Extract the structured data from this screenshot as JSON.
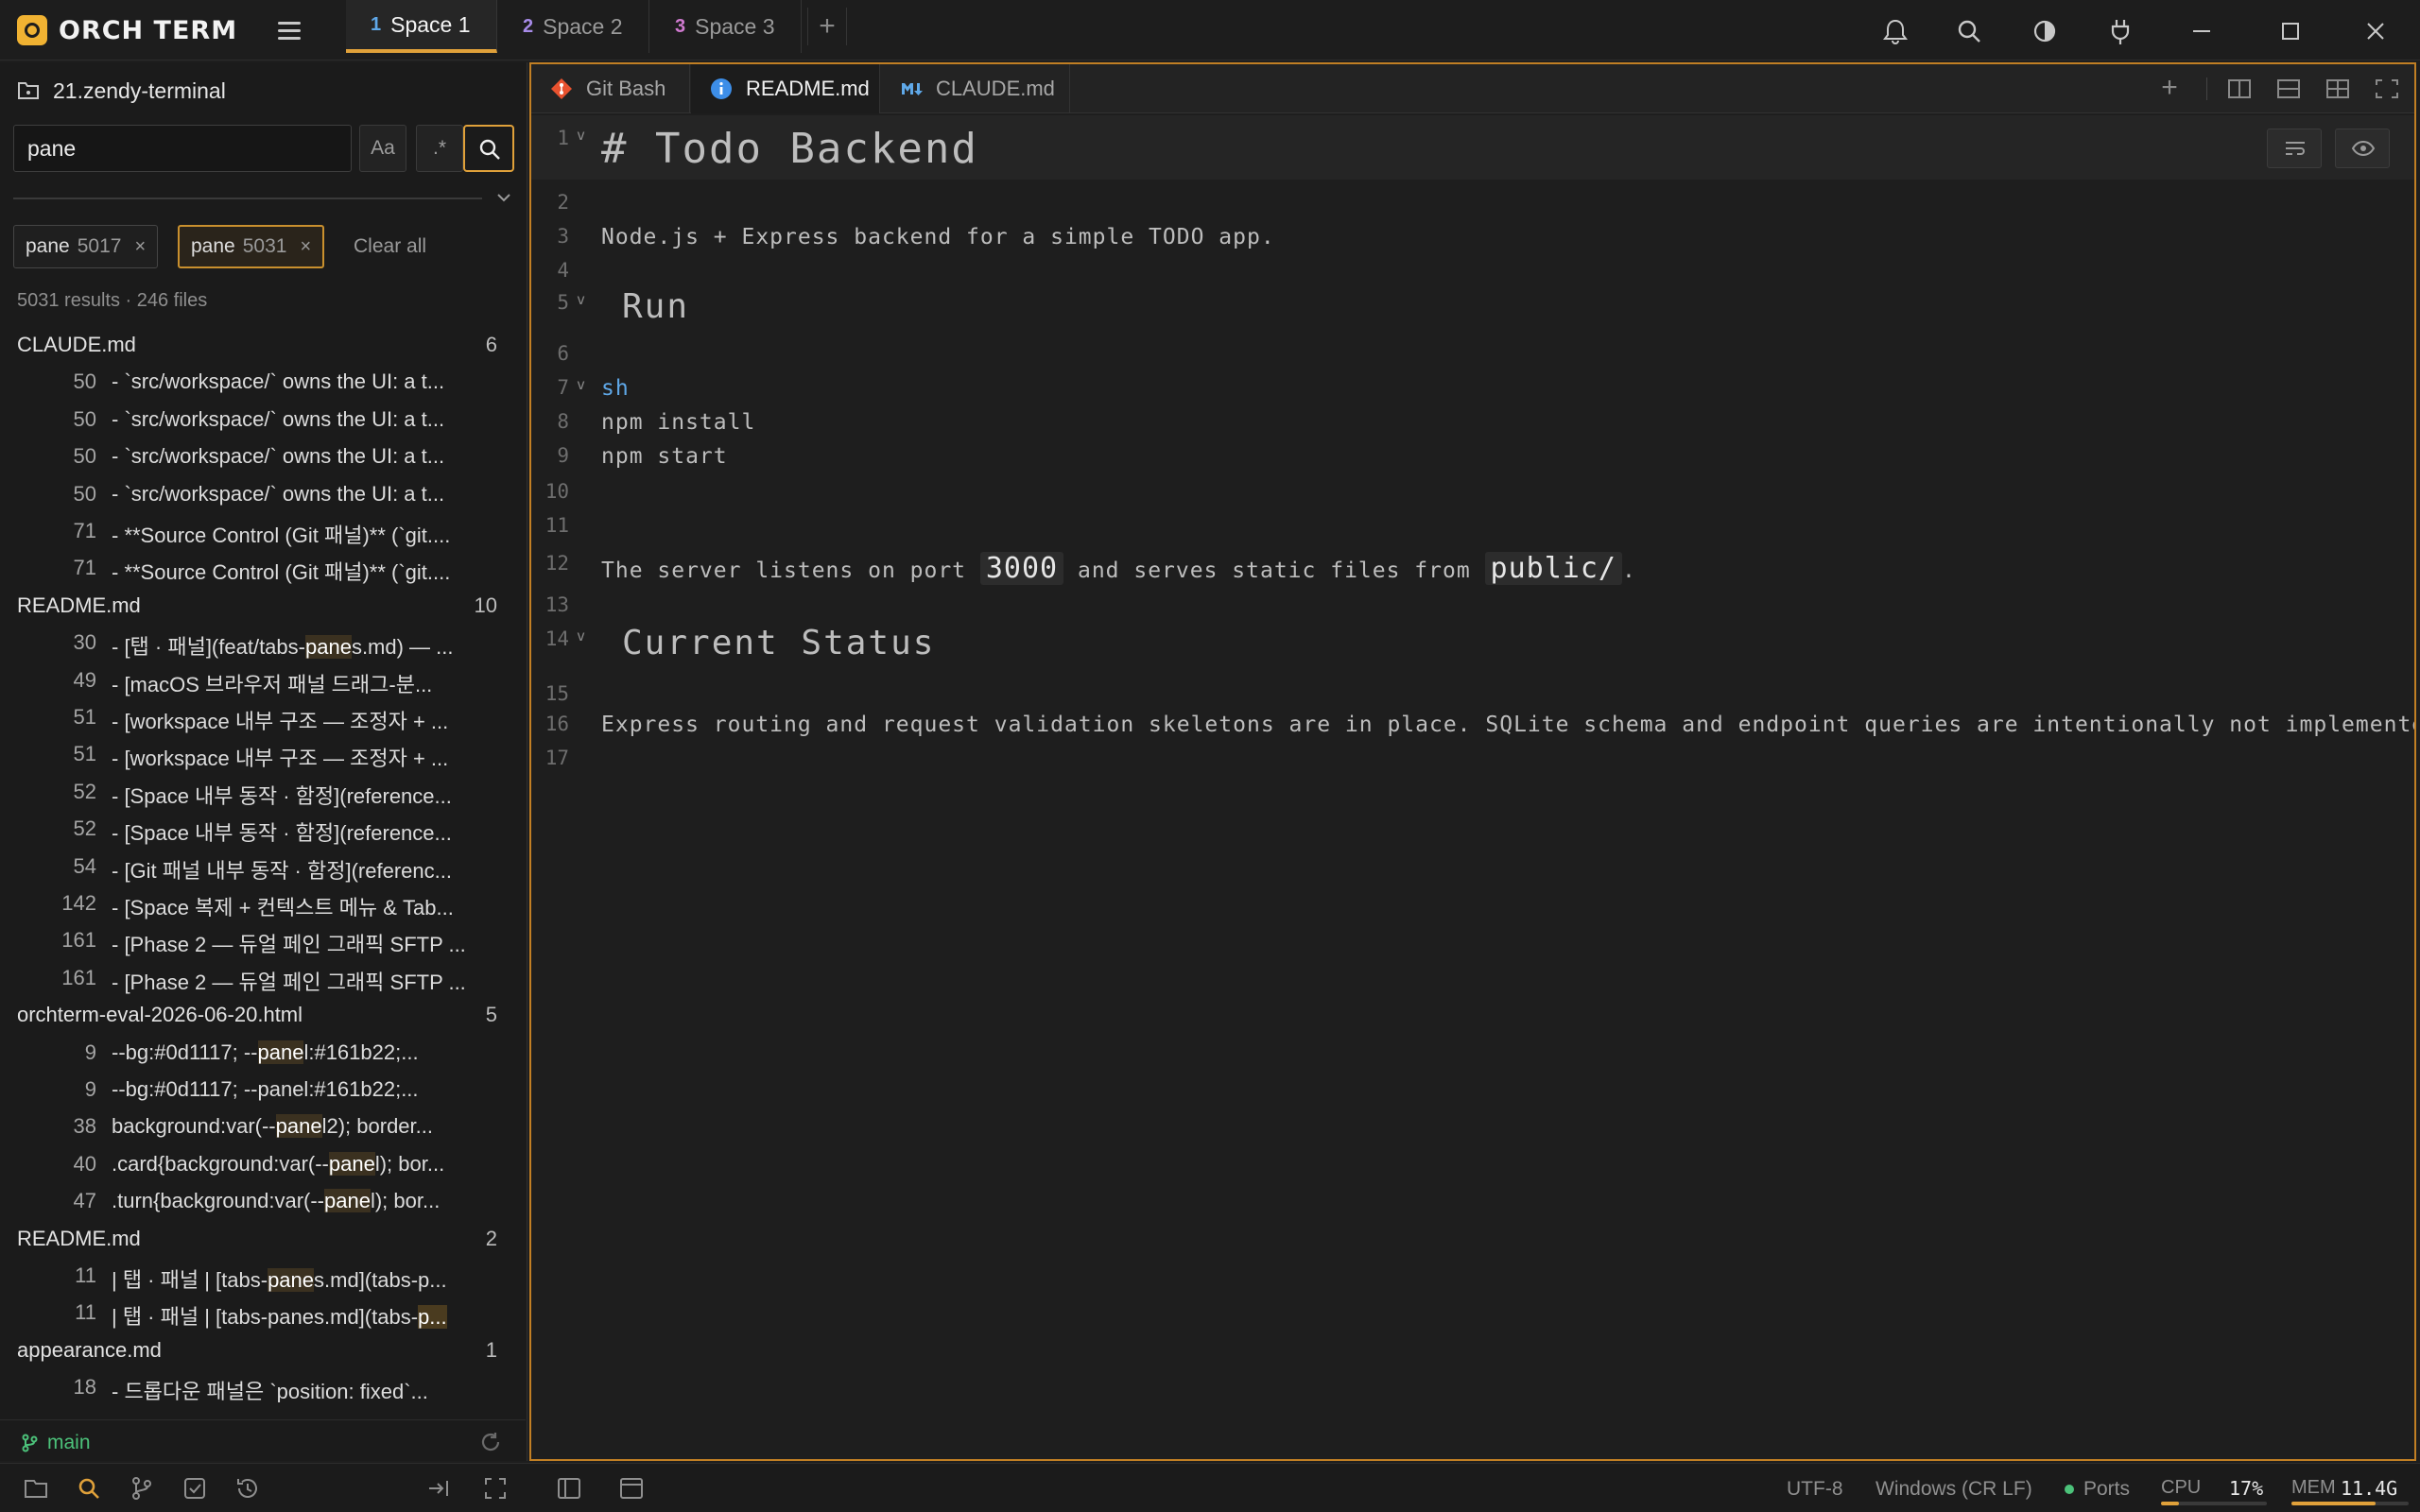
{
  "app": {
    "title": "ORCH TERM"
  },
  "spaces": [
    {
      "num": "1",
      "label": "Space 1",
      "num_color": "#5fa8e8"
    },
    {
      "num": "2",
      "label": "Space 2",
      "num_color": "#a78be8"
    },
    {
      "num": "3",
      "label": "Space 3",
      "num_color": "#d07ad0"
    }
  ],
  "add_space": "+",
  "sidebar": {
    "project": "21.zendy-terminal",
    "search": {
      "value": "pane",
      "match_case": "Aa",
      "regex": ".*"
    },
    "chips": [
      {
        "term": "pane",
        "count": "5017",
        "close": "×"
      },
      {
        "term": "pane",
        "count": "5031",
        "close": "×"
      }
    ],
    "clear_all": "Clear all",
    "summary": "5031 results · 246 files",
    "groups": [
      {
        "file": "CLAUDE.md",
        "count": "6",
        "matches": [
          {
            "line": "50",
            "pre": "- `src/workspace/` owns the UI: a t...",
            "hl": "",
            "post": ""
          },
          {
            "line": "50",
            "pre": "- `src/workspace/` owns the UI: a t...",
            "hl": "",
            "post": ""
          },
          {
            "line": "50",
            "pre": "- `src/workspace/` owns the UI: a t...",
            "hl": "",
            "post": ""
          },
          {
            "line": "50",
            "pre": "- `src/workspace/` owns the UI: a t...",
            "hl": "",
            "post": ""
          },
          {
            "line": "71",
            "pre": "- **Source Control (Git 패널)** (`git....",
            "hl": "",
            "post": ""
          },
          {
            "line": "71",
            "pre": "- **Source Control (Git 패널)** (`git....",
            "hl": "",
            "post": ""
          }
        ]
      },
      {
        "file": "README.md",
        "count": "10",
        "matches": [
          {
            "line": "30",
            "pre": "- [탭 · 패널](feat/tabs-",
            "hl": "pane",
            "post": "s.md) — ..."
          },
          {
            "line": "49",
            "pre": "- [macOS 브라우저 패널 드래그-분...",
            "hl": "",
            "post": ""
          },
          {
            "line": "51",
            "pre": "- [workspace 내부 구조 — 조정자 + ...",
            "hl": "",
            "post": ""
          },
          {
            "line": "51",
            "pre": "- [workspace 내부 구조 — 조정자 + ...",
            "hl": "",
            "post": ""
          },
          {
            "line": "52",
            "pre": "- [Space 내부 동작 · 함정](reference...",
            "hl": "",
            "post": ""
          },
          {
            "line": "52",
            "pre": "- [Space 내부 동작 · 함정](reference...",
            "hl": "",
            "post": ""
          },
          {
            "line": "54",
            "pre": "- [Git 패널 내부 동작 · 함정](referenc...",
            "hl": "",
            "post": ""
          },
          {
            "line": "142",
            "pre": "- [Space 복제 + 컨텍스트 메뉴 & Tab...",
            "hl": "",
            "post": ""
          },
          {
            "line": "161",
            "pre": "- [Phase 2 — 듀얼 페인 그래픽 SFTP ...",
            "hl": "",
            "post": ""
          },
          {
            "line": "161",
            "pre": "- [Phase 2 — 듀얼 페인 그래픽 SFTP ...",
            "hl": "",
            "post": ""
          }
        ]
      },
      {
        "file": "orchterm-eval-2026-06-20.html",
        "count": "5",
        "matches": [
          {
            "line": "9",
            "pre": "    --bg:#0d1117; --",
            "hl": "pane",
            "post": "l:#161b22;..."
          },
          {
            "line": "9",
            "pre": "    --bg:#0d1117; --panel:#161b22;...",
            "hl": "",
            "post": ""
          },
          {
            "line": "38",
            "pre": "  background:var(--",
            "hl": "pane",
            "post": "l2); border..."
          },
          {
            "line": "40",
            "pre": " .card{background:var(--",
            "hl": "pane",
            "post": "l); bor..."
          },
          {
            "line": "47",
            "pre": " .turn{background:var(--",
            "hl": "pane",
            "post": "l); bor..."
          }
        ]
      },
      {
        "file": "README.md",
        "count": "2",
        "matches": [
          {
            "line": "11",
            "pre": "| 탭 · 패널 | [tabs-",
            "hl": "pane",
            "post": "s.md](tabs-p..."
          },
          {
            "line": "11",
            "pre": "| 탭 · 패널 | [tabs-panes.md](tabs-",
            "hl": "p...",
            "post": ""
          }
        ]
      },
      {
        "file": "appearance.md",
        "count": "1",
        "matches": [
          {
            "line": "18",
            "pre": " - 드롭다운 패널은 `position: fixed`...",
            "hl": "",
            "post": ""
          }
        ]
      }
    ],
    "branch": "main"
  },
  "editor": {
    "tabs": [
      {
        "label": "Git Bash",
        "icon": "git-icon"
      },
      {
        "label": "README.md",
        "icon": "info-icon"
      },
      {
        "label": "CLAUDE.md",
        "icon": "markdown-icon"
      }
    ],
    "add_tab": "+",
    "lines": [
      {
        "n": "1",
        "fold": "v",
        "kind": "h1",
        "text": "# Todo Backend"
      },
      {
        "n": "2",
        "kind": "text",
        "text": ""
      },
      {
        "n": "3",
        "kind": "text",
        "text": "Node.js + Express backend for a simple TODO app."
      },
      {
        "n": "4",
        "kind": "text",
        "text": ""
      },
      {
        "n": "5",
        "fold": "v",
        "kind": "h2",
        "text": "Run"
      },
      {
        "n": "6",
        "kind": "text",
        "text": ""
      },
      {
        "n": "7",
        "fold": "v",
        "kind": "lang",
        "text": "sh"
      },
      {
        "n": "8",
        "kind": "text",
        "text": "npm install"
      },
      {
        "n": "9",
        "kind": "text",
        "text": "npm start"
      },
      {
        "n": "10",
        "kind": "text",
        "text": ""
      },
      {
        "n": "11",
        "kind": "text",
        "text": ""
      },
      {
        "n": "12",
        "kind": "mixed",
        "parts": [
          {
            "t": "The server listens on port "
          },
          {
            "c": "3000"
          },
          {
            "t": " and serves static files from "
          },
          {
            "c": "public/"
          },
          {
            "t": "."
          }
        ]
      },
      {
        "n": "13",
        "kind": "text",
        "text": ""
      },
      {
        "n": "14",
        "fold": "v",
        "kind": "h2",
        "text": "Current Status"
      },
      {
        "n": "15",
        "kind": "text",
        "text": ""
      },
      {
        "n": "16",
        "kind": "text",
        "text": "Express routing and request validation skeletons are in place. SQLite schema and endpoint queries are intentionally not implemented yet be"
      },
      {
        "n": "17",
        "kind": "text",
        "text": ""
      }
    ]
  },
  "status": {
    "encoding": "UTF-8",
    "eol": "Windows (CR LF)",
    "ports": "Ports",
    "cpu_label": "CPU",
    "cpu_value": "17%",
    "cpu_fraction": 0.17,
    "mem_label": "MEM",
    "mem_value": "11.4G",
    "mem_fraction": 0.72
  },
  "colors": {
    "accent": "#e0a13a",
    "branch": "#4cc27a",
    "heading": "#e8666b"
  }
}
